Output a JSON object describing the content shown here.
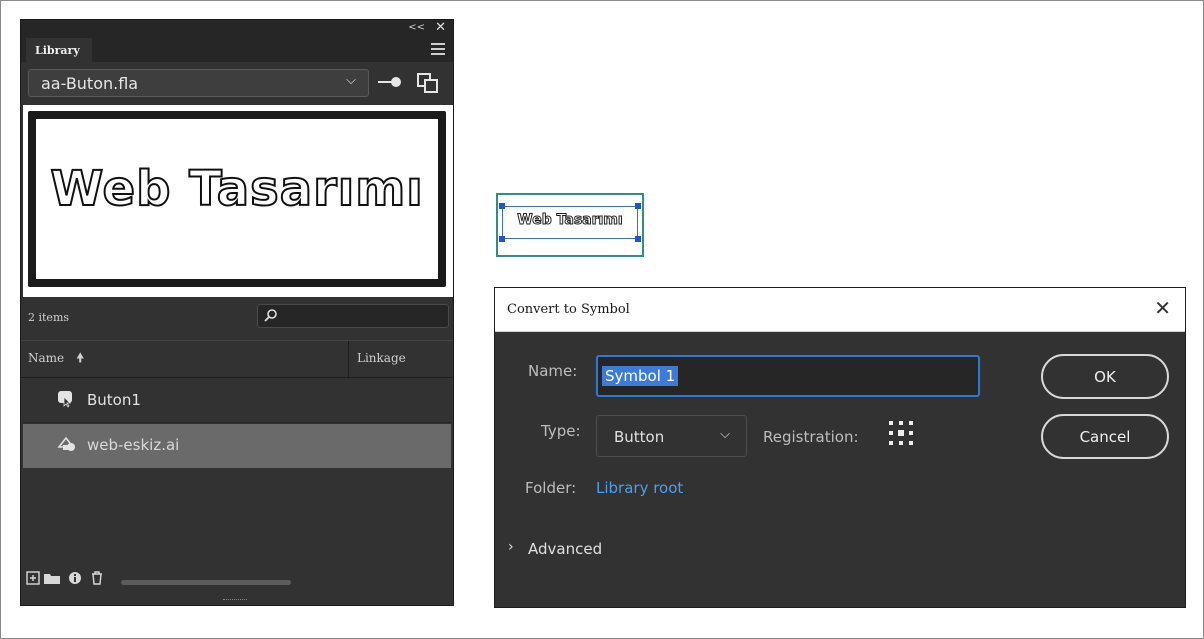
{
  "library": {
    "tab_label": "Library",
    "file": "aa-Buton.fla",
    "preview_text": "Web Tasarımı",
    "item_count": "2 items",
    "columns": {
      "name": "Name",
      "linkage": "Linkage"
    },
    "items": [
      {
        "label": "Buton1",
        "icon": "button-symbol-icon",
        "selected": false
      },
      {
        "label": "web-eskiz.ai",
        "icon": "graphic-symbol-icon",
        "selected": true
      }
    ]
  },
  "stage": {
    "symbol_text": "Web Tasarımı"
  },
  "dialog": {
    "title": "Convert to Symbol",
    "name_label": "Name:",
    "name_value": "Symbol 1",
    "type_label": "Type:",
    "type_value": "Button",
    "registration_label": "Registration:",
    "folder_label": "Folder:",
    "folder_value": "Library root",
    "advanced_label": "Advanced",
    "ok_label": "OK",
    "cancel_label": "Cancel"
  },
  "colors": {
    "panel": "#323232",
    "accent": "#2e78d6",
    "link": "#4c9ff0",
    "selected_row": "#6a6a6a"
  }
}
